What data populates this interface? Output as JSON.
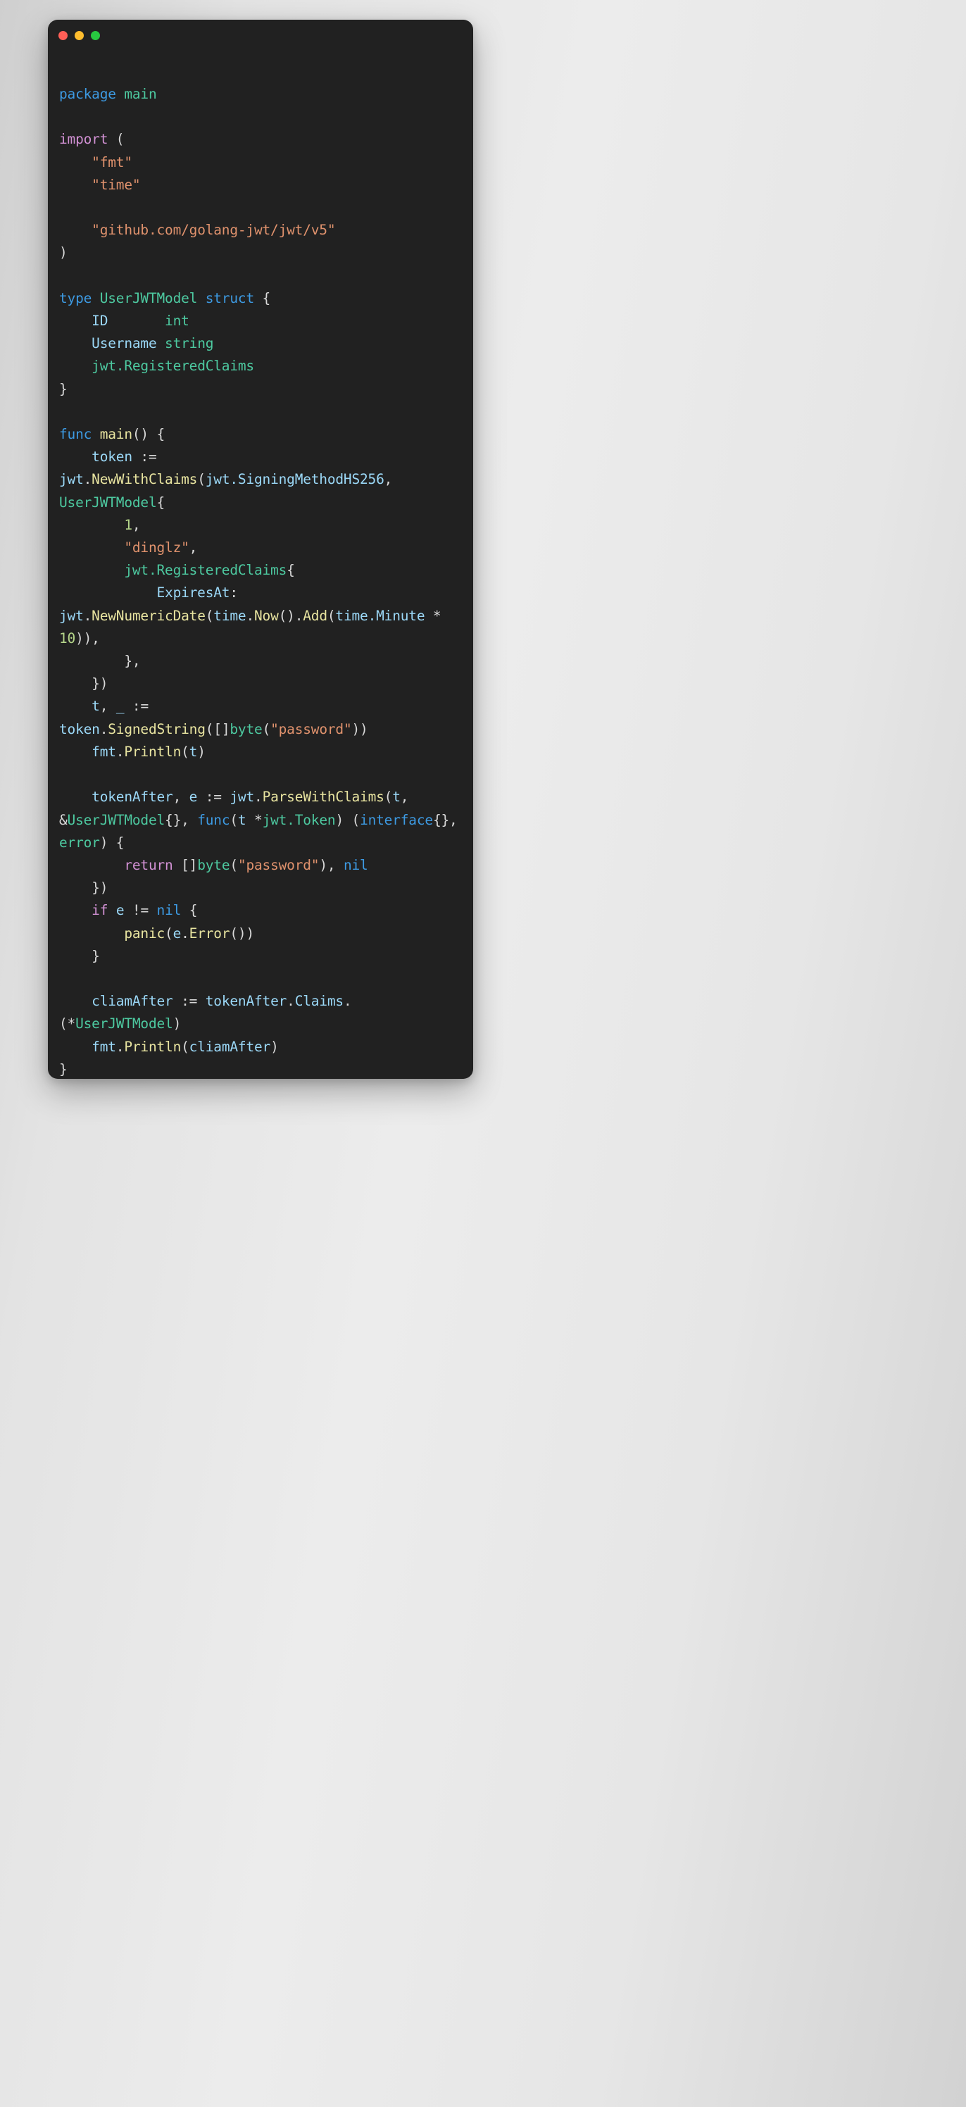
{
  "window": {
    "traffic_lights": [
      {
        "name": "close",
        "color": "#ff5f57"
      },
      {
        "name": "minimize",
        "color": "#ffbd2e"
      },
      {
        "name": "maximize",
        "color": "#28c840"
      }
    ],
    "background": "#212121"
  },
  "theme": {
    "keyword_blue": "#3d9ae2",
    "keyword_pink": "#d291d4",
    "type_green": "#4dc9a0",
    "variable_blue": "#9bd8f7",
    "function_yellow": "#e8e4a0",
    "string_orange": "#e0926d",
    "number_green": "#b5d68a",
    "punctuation": "#d8d8d8",
    "page_background": "#e6e6e6"
  },
  "code": {
    "language": "go",
    "plain_text": "package main\n\nimport (\n    \"fmt\"\n    \"time\"\n\n    \"github.com/golang-jwt/jwt/v5\"\n)\n\ntype UserJWTModel struct {\n    ID       int\n    Username string\n    jwt.RegisteredClaims\n}\n\nfunc main() {\n    token := jwt.NewWithClaims(jwt.SigningMethodHS256, UserJWTModel{\n        1,\n        \"dinglz\",\n        jwt.RegisteredClaims{\n            ExpiresAt: jwt.NewNumericDate(time.Now().Add(time.Minute * 10)),\n        },\n    })\n    t, _ := token.SignedString([]byte(\"password\"))\n    fmt.Println(t)\n\n    tokenAfter, e := jwt.ParseWithClaims(t, &UserJWTModel{}, func(t *jwt.Token) (interface{}, error) {\n        return []byte(\"password\"), nil\n    })\n    if e != nil {\n        panic(e.Error())\n    }\n\n    cliamAfter := tokenAfter.Claims.(*UserJWTModel)\n    fmt.Println(cliamAfter)\n}",
    "lines": [
      {
        "id": "l1",
        "tokens": [
          {
            "t": "package",
            "c": "k-blue"
          },
          {
            "t": " ",
            "c": "punc"
          },
          {
            "t": "main",
            "c": "type"
          }
        ]
      },
      {
        "id": "l2",
        "tokens": []
      },
      {
        "id": "l3",
        "tokens": [
          {
            "t": "import",
            "c": "k-pink"
          },
          {
            "t": " (",
            "c": "punc"
          }
        ]
      },
      {
        "id": "l4",
        "tokens": [
          {
            "t": "    ",
            "c": "punc"
          },
          {
            "t": "\"fmt\"",
            "c": "str"
          }
        ]
      },
      {
        "id": "l5",
        "tokens": [
          {
            "t": "    ",
            "c": "punc"
          },
          {
            "t": "\"time\"",
            "c": "str"
          }
        ]
      },
      {
        "id": "l6",
        "tokens": []
      },
      {
        "id": "l7",
        "tokens": [
          {
            "t": "    ",
            "c": "punc"
          },
          {
            "t": "\"github.com/golang-jwt/jwt/v5\"",
            "c": "str"
          }
        ]
      },
      {
        "id": "l8",
        "tokens": [
          {
            "t": ")",
            "c": "punc"
          }
        ]
      },
      {
        "id": "l9",
        "tokens": []
      },
      {
        "id": "l10",
        "tokens": [
          {
            "t": "type",
            "c": "k-blue"
          },
          {
            "t": " ",
            "c": "punc"
          },
          {
            "t": "UserJWTModel",
            "c": "type"
          },
          {
            "t": " ",
            "c": "punc"
          },
          {
            "t": "struct",
            "c": "k-blue"
          },
          {
            "t": " {",
            "c": "punc"
          }
        ]
      },
      {
        "id": "l11",
        "tokens": [
          {
            "t": "    ",
            "c": "punc"
          },
          {
            "t": "ID",
            "c": "var"
          },
          {
            "t": "       ",
            "c": "punc"
          },
          {
            "t": "int",
            "c": "type"
          }
        ]
      },
      {
        "id": "l12",
        "tokens": [
          {
            "t": "    ",
            "c": "punc"
          },
          {
            "t": "Username",
            "c": "var"
          },
          {
            "t": " ",
            "c": "punc"
          },
          {
            "t": "string",
            "c": "type"
          }
        ]
      },
      {
        "id": "l13",
        "tokens": [
          {
            "t": "    ",
            "c": "punc"
          },
          {
            "t": "jwt.RegisteredClaims",
            "c": "type"
          }
        ]
      },
      {
        "id": "l14",
        "tokens": [
          {
            "t": "}",
            "c": "punc"
          }
        ]
      },
      {
        "id": "l15",
        "tokens": []
      },
      {
        "id": "l16",
        "tokens": [
          {
            "t": "func",
            "c": "k-blue"
          },
          {
            "t": " ",
            "c": "punc"
          },
          {
            "t": "main",
            "c": "fn"
          },
          {
            "t": "() {",
            "c": "punc"
          }
        ]
      },
      {
        "id": "l17",
        "tokens": [
          {
            "t": "    ",
            "c": "punc"
          },
          {
            "t": "token",
            "c": "var"
          },
          {
            "t": " := ",
            "c": "punc"
          },
          {
            "t": "jwt",
            "c": "var"
          },
          {
            "t": ".",
            "c": "punc"
          },
          {
            "t": "NewWithClaims",
            "c": "fn"
          },
          {
            "t": "(",
            "c": "punc"
          },
          {
            "t": "jwt.SigningMethodHS256",
            "c": "var"
          },
          {
            "t": ", ",
            "c": "punc"
          },
          {
            "t": "UserJWTModel",
            "c": "type"
          },
          {
            "t": "{",
            "c": "punc"
          }
        ]
      },
      {
        "id": "l18",
        "tokens": [
          {
            "t": "        ",
            "c": "punc"
          },
          {
            "t": "1",
            "c": "num"
          },
          {
            "t": ",",
            "c": "punc"
          }
        ]
      },
      {
        "id": "l19",
        "tokens": [
          {
            "t": "        ",
            "c": "punc"
          },
          {
            "t": "\"dinglz\"",
            "c": "str"
          },
          {
            "t": ",",
            "c": "punc"
          }
        ]
      },
      {
        "id": "l20",
        "tokens": [
          {
            "t": "        ",
            "c": "punc"
          },
          {
            "t": "jwt.RegisteredClaims",
            "c": "type"
          },
          {
            "t": "{",
            "c": "punc"
          }
        ]
      },
      {
        "id": "l21",
        "tokens": [
          {
            "t": "            ",
            "c": "punc"
          },
          {
            "t": "ExpiresAt",
            "c": "var"
          },
          {
            "t": ": ",
            "c": "punc"
          },
          {
            "t": "jwt",
            "c": "var"
          },
          {
            "t": ".",
            "c": "punc"
          },
          {
            "t": "NewNumericDate",
            "c": "fn"
          },
          {
            "t": "(",
            "c": "punc"
          },
          {
            "t": "time",
            "c": "var"
          },
          {
            "t": ".",
            "c": "punc"
          },
          {
            "t": "Now",
            "c": "fn"
          },
          {
            "t": "().",
            "c": "punc"
          },
          {
            "t": "Add",
            "c": "fn"
          },
          {
            "t": "(",
            "c": "punc"
          },
          {
            "t": "time.Minute",
            "c": "var"
          },
          {
            "t": " * ",
            "c": "punc"
          },
          {
            "t": "10",
            "c": "num"
          },
          {
            "t": ")),",
            "c": "punc"
          }
        ]
      },
      {
        "id": "l22",
        "tokens": [
          {
            "t": "        },",
            "c": "punc"
          }
        ]
      },
      {
        "id": "l23",
        "tokens": [
          {
            "t": "    })",
            "c": "punc"
          }
        ]
      },
      {
        "id": "l24",
        "tokens": [
          {
            "t": "    ",
            "c": "punc"
          },
          {
            "t": "t",
            "c": "var"
          },
          {
            "t": ", ",
            "c": "punc"
          },
          {
            "t": "_",
            "c": "var"
          },
          {
            "t": " := ",
            "c": "punc"
          },
          {
            "t": "token",
            "c": "var"
          },
          {
            "t": ".",
            "c": "punc"
          },
          {
            "t": "SignedString",
            "c": "fn"
          },
          {
            "t": "([]",
            "c": "punc"
          },
          {
            "t": "byte",
            "c": "type"
          },
          {
            "t": "(",
            "c": "punc"
          },
          {
            "t": "\"password\"",
            "c": "str"
          },
          {
            "t": "))",
            "c": "punc"
          }
        ]
      },
      {
        "id": "l25",
        "tokens": [
          {
            "t": "    ",
            "c": "punc"
          },
          {
            "t": "fmt",
            "c": "var"
          },
          {
            "t": ".",
            "c": "punc"
          },
          {
            "t": "Println",
            "c": "fn"
          },
          {
            "t": "(",
            "c": "punc"
          },
          {
            "t": "t",
            "c": "var"
          },
          {
            "t": ")",
            "c": "punc"
          }
        ]
      },
      {
        "id": "l26",
        "tokens": []
      },
      {
        "id": "l27",
        "tokens": [
          {
            "t": "    ",
            "c": "punc"
          },
          {
            "t": "tokenAfter",
            "c": "var"
          },
          {
            "t": ", ",
            "c": "punc"
          },
          {
            "t": "e",
            "c": "var"
          },
          {
            "t": " := ",
            "c": "punc"
          },
          {
            "t": "jwt",
            "c": "var"
          },
          {
            "t": ".",
            "c": "punc"
          },
          {
            "t": "ParseWithClaims",
            "c": "fn"
          },
          {
            "t": "(",
            "c": "punc"
          },
          {
            "t": "t",
            "c": "var"
          },
          {
            "t": ", &",
            "c": "punc"
          },
          {
            "t": "UserJWTModel",
            "c": "type"
          },
          {
            "t": "{}, ",
            "c": "punc"
          },
          {
            "t": "func",
            "c": "k-blue"
          },
          {
            "t": "(",
            "c": "punc"
          },
          {
            "t": "t",
            "c": "var"
          },
          {
            "t": " *",
            "c": "punc"
          },
          {
            "t": "jwt.Token",
            "c": "type"
          },
          {
            "t": ") (",
            "c": "punc"
          },
          {
            "t": "interface",
            "c": "k-blue"
          },
          {
            "t": "{}, ",
            "c": "punc"
          },
          {
            "t": "error",
            "c": "type"
          },
          {
            "t": ") {",
            "c": "punc"
          }
        ]
      },
      {
        "id": "l28",
        "tokens": [
          {
            "t": "        ",
            "c": "punc"
          },
          {
            "t": "return",
            "c": "k-pink"
          },
          {
            "t": " []",
            "c": "punc"
          },
          {
            "t": "byte",
            "c": "type"
          },
          {
            "t": "(",
            "c": "punc"
          },
          {
            "t": "\"password\"",
            "c": "str"
          },
          {
            "t": "), ",
            "c": "punc"
          },
          {
            "t": "nil",
            "c": "k-blue"
          }
        ]
      },
      {
        "id": "l29",
        "tokens": [
          {
            "t": "    })",
            "c": "punc"
          }
        ]
      },
      {
        "id": "l30",
        "tokens": [
          {
            "t": "    ",
            "c": "punc"
          },
          {
            "t": "if",
            "c": "k-pink"
          },
          {
            "t": " ",
            "c": "punc"
          },
          {
            "t": "e",
            "c": "var"
          },
          {
            "t": " != ",
            "c": "punc"
          },
          {
            "t": "nil",
            "c": "k-blue"
          },
          {
            "t": " {",
            "c": "punc"
          }
        ]
      },
      {
        "id": "l31",
        "tokens": [
          {
            "t": "        ",
            "c": "punc"
          },
          {
            "t": "panic",
            "c": "fn"
          },
          {
            "t": "(",
            "c": "punc"
          },
          {
            "t": "e",
            "c": "var"
          },
          {
            "t": ".",
            "c": "punc"
          },
          {
            "t": "Error",
            "c": "fn"
          },
          {
            "t": "())",
            "c": "punc"
          }
        ]
      },
      {
        "id": "l32",
        "tokens": [
          {
            "t": "    }",
            "c": "punc"
          }
        ]
      },
      {
        "id": "l33",
        "tokens": []
      },
      {
        "id": "l34",
        "tokens": [
          {
            "t": "    ",
            "c": "punc"
          },
          {
            "t": "cliamAfter",
            "c": "var"
          },
          {
            "t": " := ",
            "c": "punc"
          },
          {
            "t": "tokenAfter",
            "c": "var"
          },
          {
            "t": ".",
            "c": "punc"
          },
          {
            "t": "Claims",
            "c": "var"
          },
          {
            "t": ".(*",
            "c": "punc"
          },
          {
            "t": "UserJWTModel",
            "c": "type"
          },
          {
            "t": ")",
            "c": "punc"
          }
        ]
      },
      {
        "id": "l35",
        "tokens": [
          {
            "t": "    ",
            "c": "punc"
          },
          {
            "t": "fmt",
            "c": "var"
          },
          {
            "t": ".",
            "c": "punc"
          },
          {
            "t": "Println",
            "c": "fn"
          },
          {
            "t": "(",
            "c": "punc"
          },
          {
            "t": "cliamAfter",
            "c": "var"
          },
          {
            "t": ")",
            "c": "punc"
          }
        ]
      },
      {
        "id": "l36",
        "tokens": [
          {
            "t": "}",
            "c": "punc"
          }
        ]
      }
    ]
  }
}
